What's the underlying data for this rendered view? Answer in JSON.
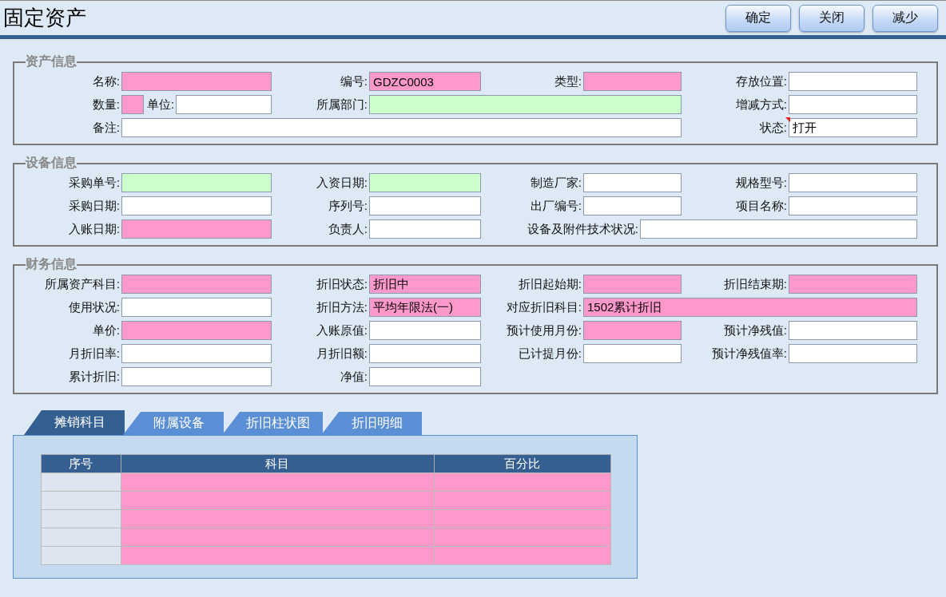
{
  "title": "固定资产",
  "buttons": [
    "确定",
    "关闭",
    "减少"
  ],
  "sections": [
    {
      "legend": "资产信息",
      "rows": [
        [
          {
            "label": "名称:",
            "kind": "required"
          },
          {
            "label": "编号:",
            "kind": "required",
            "value": "GDZC0003"
          },
          {
            "label": "类型:",
            "kind": "required"
          },
          {
            "label": "存放位置:",
            "kind": "plain"
          }
        ],
        [
          {
            "label": "数量:",
            "kind": "required"
          },
          {
            "label": "单位:",
            "kind": "plain"
          },
          {
            "label": "所属部门:",
            "kind": "lookup"
          },
          {
            "label": "增减方式:",
            "kind": "plain"
          }
        ],
        [
          {
            "label": "备注:",
            "kind": "plain"
          },
          {
            "label": "状态:",
            "kind": "plain",
            "value": "打开",
            "flagged": true
          }
        ]
      ]
    },
    {
      "legend": "设备信息",
      "rows": [
        [
          {
            "label": "采购单号:",
            "kind": "lookup"
          },
          {
            "label": "入资日期:",
            "kind": "lookup"
          },
          {
            "label": "制造厂家:",
            "kind": "plain"
          },
          {
            "label": "规格型号:",
            "kind": "plain"
          }
        ],
        [
          {
            "label": "采购日期:",
            "kind": "plain"
          },
          {
            "label": "序列号:",
            "kind": "plain"
          },
          {
            "label": "出厂编号:",
            "kind": "plain"
          },
          {
            "label": "项目名称:",
            "kind": "plain"
          }
        ],
        [
          {
            "label": "入账日期:",
            "kind": "required"
          },
          {
            "label": "负责人:",
            "kind": "plain"
          },
          {
            "label": "设备及附件技术状况:",
            "kind": "plain"
          }
        ]
      ]
    },
    {
      "legend": "财务信息",
      "rows": [
        [
          {
            "label": "所属资产科目:",
            "kind": "required"
          },
          {
            "label": "折旧状态:",
            "kind": "required",
            "value": "折旧中"
          },
          {
            "label": "折旧起始期:",
            "kind": "required"
          },
          {
            "label": "折旧结束期:",
            "kind": "required"
          }
        ],
        [
          {
            "label": "使用状况:",
            "kind": "plain"
          },
          {
            "label": "折旧方法:",
            "kind": "required",
            "value": "平均年限法(一)"
          },
          {
            "label": "对应折旧科目:",
            "kind": "required",
            "value": "1502累计折旧"
          }
        ],
        [
          {
            "label": "单价:",
            "kind": "required"
          },
          {
            "label": "入账原值:",
            "kind": "plain"
          },
          {
            "label": "预计使用月份:",
            "kind": "required"
          },
          {
            "label": "预计净残值:",
            "kind": "plain"
          }
        ],
        [
          {
            "label": "月折旧率:",
            "kind": "plain"
          },
          {
            "label": "月折旧额:",
            "kind": "plain"
          },
          {
            "label": "已计提月份:",
            "kind": "plain"
          },
          {
            "label": "预计净残值率:",
            "kind": "plain"
          }
        ],
        [
          {
            "label": "累计折旧:",
            "kind": "plain"
          },
          {
            "label": "净值:",
            "kind": "plain"
          }
        ]
      ]
    }
  ],
  "tabs": [
    {
      "label": "摊销科目",
      "selected": true
    },
    {
      "label": "附属设备",
      "selected": false
    },
    {
      "label": "折旧柱状图",
      "selected": false
    },
    {
      "label": "折旧明细",
      "selected": false
    }
  ],
  "grid": {
    "columns": [
      "序号",
      "科目",
      "百分比"
    ],
    "rows": [
      {
        "required": true
      },
      {
        "required": true
      },
      {
        "required": true
      },
      {
        "required": true
      },
      {
        "required": true
      }
    ]
  }
}
